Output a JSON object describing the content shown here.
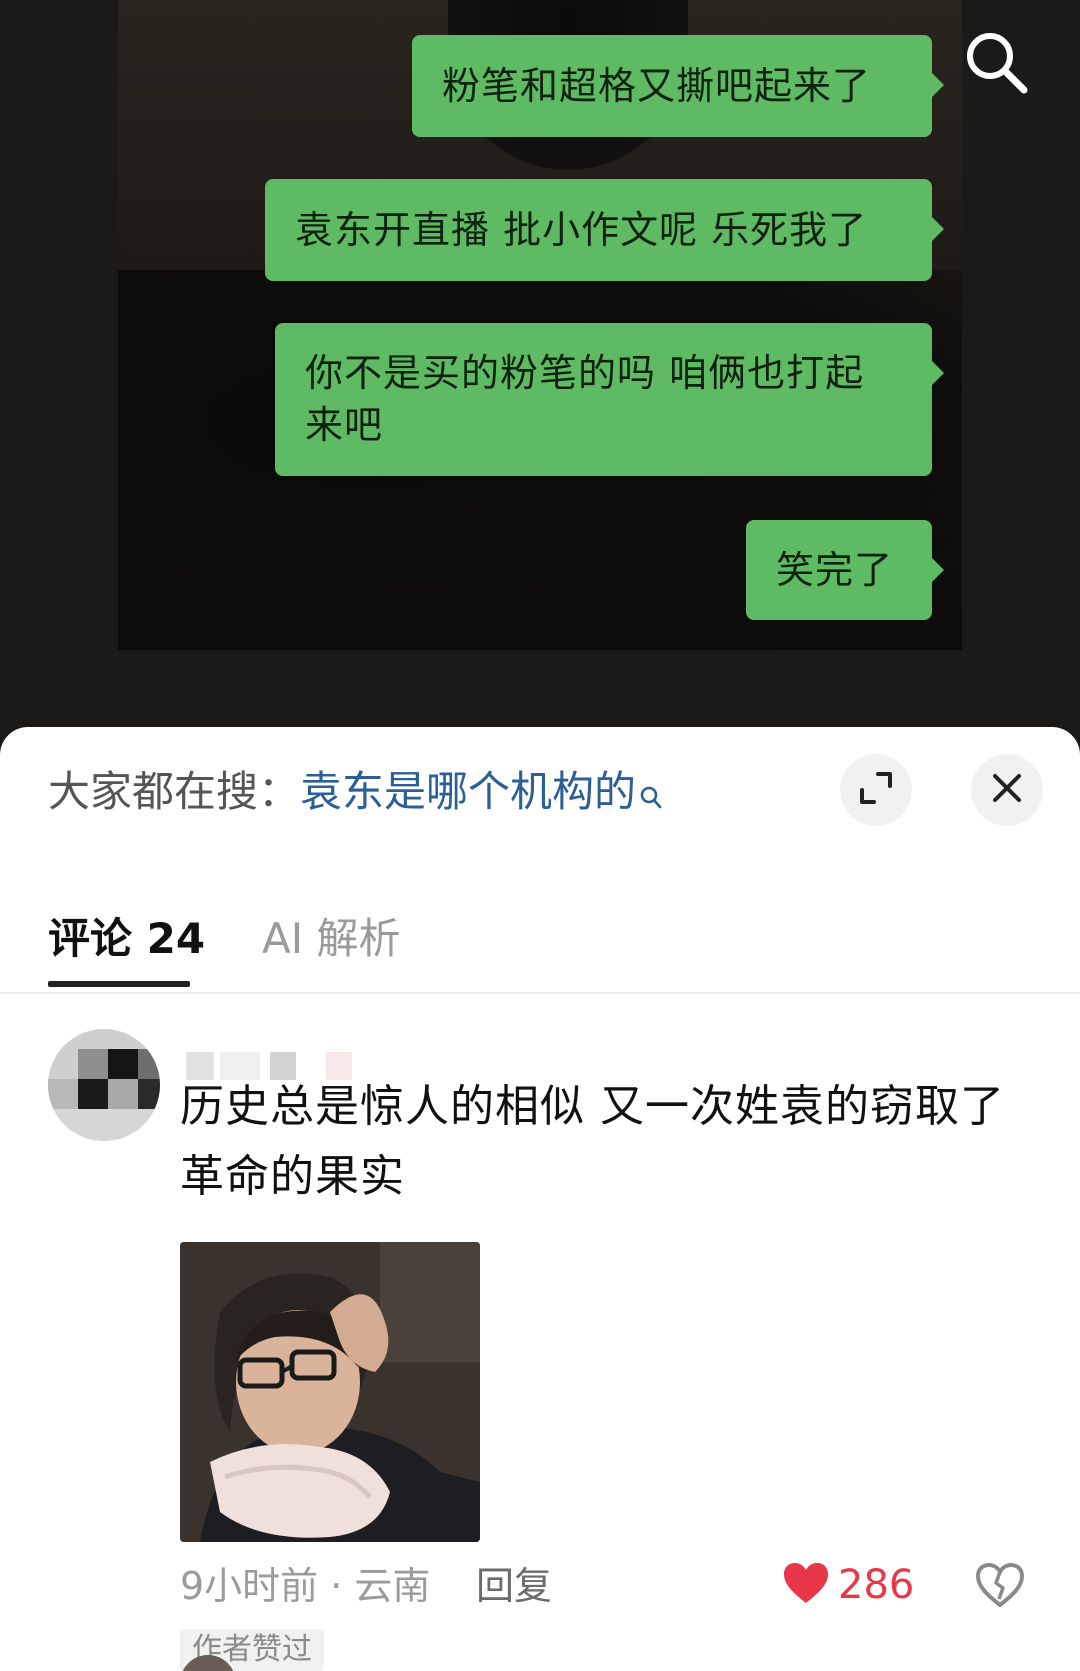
{
  "chat": {
    "messages": [
      "粉笔和超格又撕吧起来了",
      "袁东开直播 批小作文呢 乐死我了",
      "你不是买的粉笔的吗 咱俩也打起来吧",
      "笑完了"
    ],
    "bubble_color": "#5fbb63"
  },
  "top_bar": {
    "search_icon": "search-icon"
  },
  "hot_search": {
    "label": "大家都在搜：",
    "query": "袁东是哪个机构的",
    "query_color": "#2c5f96",
    "icon": "search-icon"
  },
  "panel_buttons": {
    "expand_icon": "expand-icon",
    "close_icon": "close-icon"
  },
  "tabs": {
    "comments": "评论 24",
    "ai": "AI 解析"
  },
  "comment": {
    "avatar": "avatar",
    "text": "历史总是惊人的相似 又一次姓袁的窃取了革命的果实",
    "photo": "photo-of-woman-with-glasses",
    "time_location": "9小时前 · 云南",
    "reply": "回复",
    "likes": "286",
    "like_color": "#e9374a",
    "author_badge": "作者赞过"
  }
}
